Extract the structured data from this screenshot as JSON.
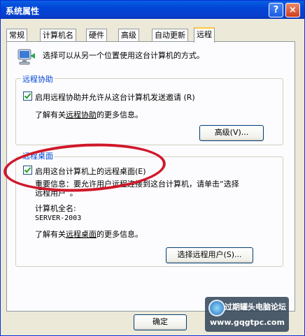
{
  "window": {
    "title": "系统属性",
    "help": "?",
    "close": "×"
  },
  "tabs": [
    "常规",
    "计算机名",
    "硬件",
    "高级",
    "自动更新",
    "远程"
  ],
  "intro_text": "选择可以从另一个位置使用这台计算机的方式。",
  "remote_assistance": {
    "title": "远程协助",
    "checkbox_label": "启用远程协助并允许从这台计算机发送邀请 (R)",
    "info_prefix": "了解有关",
    "info_link": "远程协助",
    "info_suffix": "的更多信息。",
    "advanced_button": "高级(V)..."
  },
  "remote_desktop": {
    "title": "远程桌面",
    "checkbox_label": "启用这台计算机上的远程桌面(E)",
    "important_line1": "重要信息：要允许用户远程连接到这台计算机，请单击“选择",
    "important_line2": "远程用户”。",
    "computer_name_label": "计算机全名:",
    "computer_name_value": "SERVER-2003",
    "info_prefix": "了解有关",
    "info_link": "远程桌面",
    "info_suffix": "的更多信息。",
    "select_users_button": "选择远程用户(S)..."
  },
  "footer": {
    "ok": "确定"
  },
  "watermark": {
    "name": "过期罐头电脑论坛",
    "url": "www.gqgtpc.com"
  }
}
